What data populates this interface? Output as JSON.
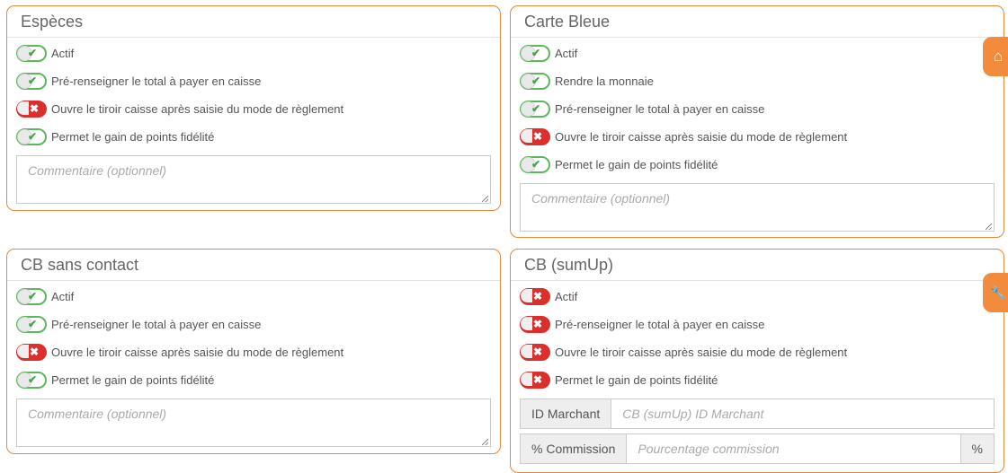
{
  "panels": {
    "especes": {
      "title": "Espèces",
      "rows": [
        {
          "label": "Actif",
          "state": "on"
        },
        {
          "label": "Pré-renseigner le total à payer en caisse",
          "state": "on"
        },
        {
          "label": "Ouvre le tiroir caisse après saisie du mode de règlement",
          "state": "off"
        },
        {
          "label": "Permet le gain de points fidélité",
          "state": "on"
        }
      ],
      "comment_placeholder": "Commentaire (optionnel)"
    },
    "carte_bleue": {
      "title": "Carte Bleue",
      "rows": [
        {
          "label": "Actif",
          "state": "on"
        },
        {
          "label": "Rendre la monnaie",
          "state": "on"
        },
        {
          "label": "Pré-renseigner le total à payer en caisse",
          "state": "on"
        },
        {
          "label": "Ouvre le tiroir caisse après saisie du mode de règlement",
          "state": "off"
        },
        {
          "label": "Permet le gain de points fidélité",
          "state": "on"
        }
      ],
      "comment_placeholder": "Commentaire (optionnel)"
    },
    "cb_sans_contact": {
      "title": "CB sans contact",
      "rows": [
        {
          "label": "Actif",
          "state": "on"
        },
        {
          "label": "Pré-renseigner le total à payer en caisse",
          "state": "on"
        },
        {
          "label": "Ouvre le tiroir caisse après saisie du mode de règlement",
          "state": "off"
        },
        {
          "label": "Permet le gain de points fidélité",
          "state": "on"
        }
      ],
      "comment_placeholder": "Commentaire (optionnel)"
    },
    "cb_sumup": {
      "title": "CB (sumUp)",
      "rows": [
        {
          "label": "Actif",
          "state": "off"
        },
        {
          "label": "Pré-renseigner le total à payer en caisse",
          "state": "off"
        },
        {
          "label": "Ouvre le tiroir caisse après saisie du mode de règlement",
          "state": "off"
        },
        {
          "label": "Permet le gain de points fidélité",
          "state": "off"
        }
      ],
      "merchant_id": {
        "addon": "ID Marchant",
        "placeholder": "CB (sumUp) ID Marchant"
      },
      "commission": {
        "addon": "% Commission",
        "placeholder": "Pourcentage commission",
        "suffix": "%"
      }
    }
  },
  "toggle_glyphs": {
    "on": "✔",
    "off": "✖"
  },
  "side_buttons": {
    "home_icon": "⌂",
    "wrench_icon": "🔧"
  },
  "colors": {
    "border": "#e8863a",
    "on": "#5cb85c",
    "off": "#d9302c",
    "side_button": "#f28c3c"
  }
}
